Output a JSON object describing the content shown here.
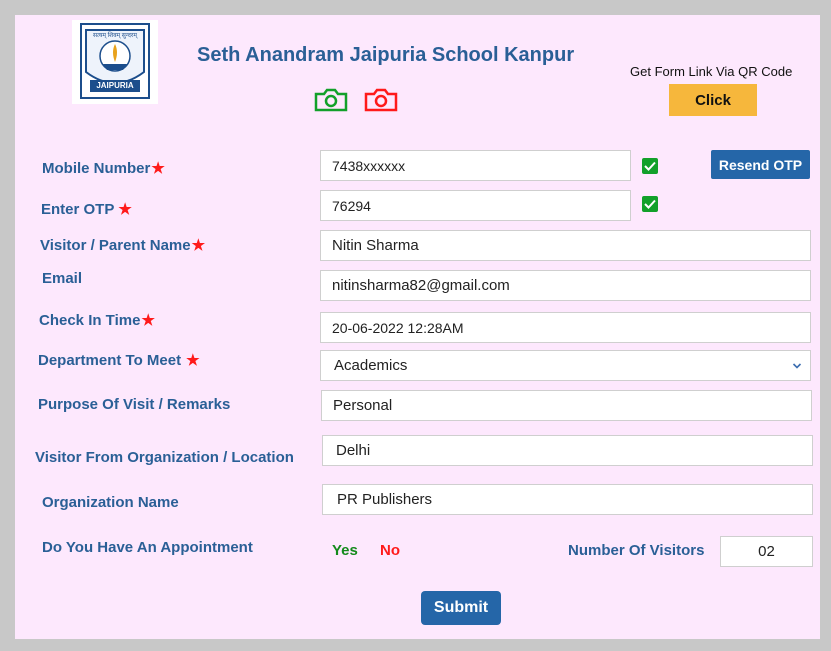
{
  "header": {
    "school_name": "Seth Anandram Jaipuria School Kanpur",
    "logo_text_top": "सत्यम् शिवम् सुन्दरम्",
    "logo_text_bottom": "JAIPURIA",
    "qr_label": "Get Form Link Via QR Code",
    "qr_button": "Click",
    "camera_icons": [
      "camera-icon-green",
      "camera-icon-red"
    ]
  },
  "form": {
    "mobile": {
      "label": "Mobile Number",
      "value": "7438xxxxxx",
      "required": true,
      "verified": true
    },
    "resend_otp": "Resend OTP",
    "otp": {
      "label": "Enter OTP",
      "value": "76294",
      "required": true,
      "verified": true
    },
    "visitor_name": {
      "label": "Visitor / Parent Name",
      "value": "Nitin Sharma",
      "required": true
    },
    "email": {
      "label": "Email",
      "value": "nitinsharma82@gmail.com"
    },
    "check_in": {
      "label": "Check In Time",
      "value": "20-06-2022 12:28AM",
      "required": true
    },
    "department": {
      "label": "Department To Meet",
      "value": "Academics",
      "required": true
    },
    "purpose": {
      "label": "Purpose Of Visit / Remarks",
      "value": "Personal"
    },
    "from_org": {
      "label": "Visitor From Organization / Location",
      "value": "Delhi"
    },
    "org_name": {
      "label": "Organization Name",
      "value": "PR Publishers"
    },
    "appointment": {
      "label": "Do You Have An Appointment",
      "yes": "Yes",
      "no": "No"
    },
    "visitors": {
      "label": "Number Of Visitors",
      "value": "02"
    },
    "submit": "Submit"
  },
  "colors": {
    "brand": "#2a5f96",
    "button": "#2566a8",
    "qr_button": "#f6b73c",
    "yes": "#138a1b",
    "no": "#ff1a1a",
    "required_star": "#ff1a1a",
    "check": "#12a02a"
  }
}
